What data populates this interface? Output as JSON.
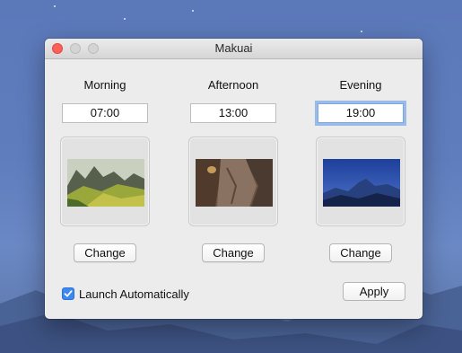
{
  "window": {
    "title": "Makuai"
  },
  "slots": [
    {
      "label": "Morning",
      "time": "07:00",
      "thumbnail": "green-mountains-wallpaper",
      "change_label": "Change"
    },
    {
      "label": "Afternoon",
      "time": "13:00",
      "thumbnail": "rock-cliff-wallpaper",
      "change_label": "Change"
    },
    {
      "label": "Evening",
      "time": "19:00",
      "thumbnail": "blue-mountains-wallpaper",
      "change_label": "Change"
    }
  ],
  "launch": {
    "label": "Launch Automatically",
    "checked": true
  },
  "apply_label": "Apply",
  "colors": {
    "accent": "#3b88f0",
    "close": "#fc605b",
    "window_bg": "#ececec"
  }
}
